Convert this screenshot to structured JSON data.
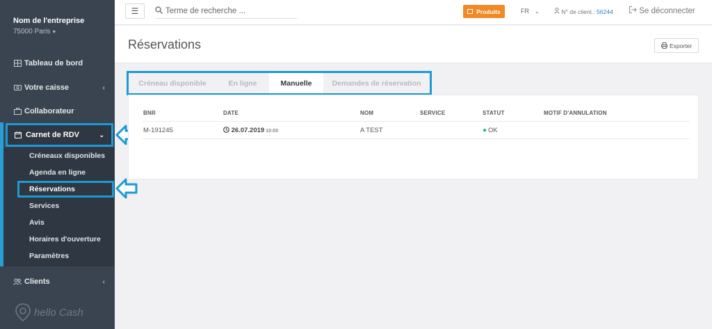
{
  "sidebar": {
    "company_name": "Nom de l'entreprise",
    "company_city": "75000 Paris",
    "items": [
      {
        "label": "Tableau de bord",
        "icon": "dashboard-icon"
      },
      {
        "label": "Votre caisse",
        "icon": "register-icon"
      },
      {
        "label": "Collaborateur",
        "icon": "employee-icon"
      },
      {
        "label": "Carnet de RDV",
        "icon": "calendar-icon"
      },
      {
        "label": "Clients",
        "icon": "clients-icon"
      }
    ],
    "submenu": [
      {
        "label": "Créneaux disponibles"
      },
      {
        "label": "Agenda en ligne"
      },
      {
        "label": "Réservations"
      },
      {
        "label": "Services"
      },
      {
        "label": "Avis"
      },
      {
        "label": "Horaires d'ouverture"
      },
      {
        "label": "Paramètres"
      }
    ],
    "logo_text": "hello Cash"
  },
  "topbar": {
    "search_placeholder": "Terme de recherche ...",
    "products_label": "Produits",
    "language": "FR",
    "client_label": "N° de client.:",
    "client_number": "56244",
    "logout_label": "Se déconnecter"
  },
  "page": {
    "title": "Réservations",
    "export_label": "Exporter"
  },
  "tabs": [
    {
      "label": "Créneau disponible",
      "active": false
    },
    {
      "label": "En ligne",
      "active": false
    },
    {
      "label": "Manuelle",
      "active": true
    },
    {
      "label": "Demandes de réservation",
      "active": false
    }
  ],
  "table": {
    "columns": [
      "BNR",
      "DATE",
      "NOM",
      "SERVICE",
      "STATUT",
      "MOTIF D'ANNULATION"
    ],
    "rows": [
      {
        "bnr": "M-191245",
        "date": "26.07.2019",
        "time": "10:00",
        "nom": "A TEST",
        "service": "",
        "statut": "OK",
        "motif": ""
      }
    ]
  },
  "colors": {
    "sidebar_bg": "#3a4450",
    "highlight": "#1a9ad6",
    "products_btn": "#f08a24",
    "status_ok": "#2eb39a"
  }
}
